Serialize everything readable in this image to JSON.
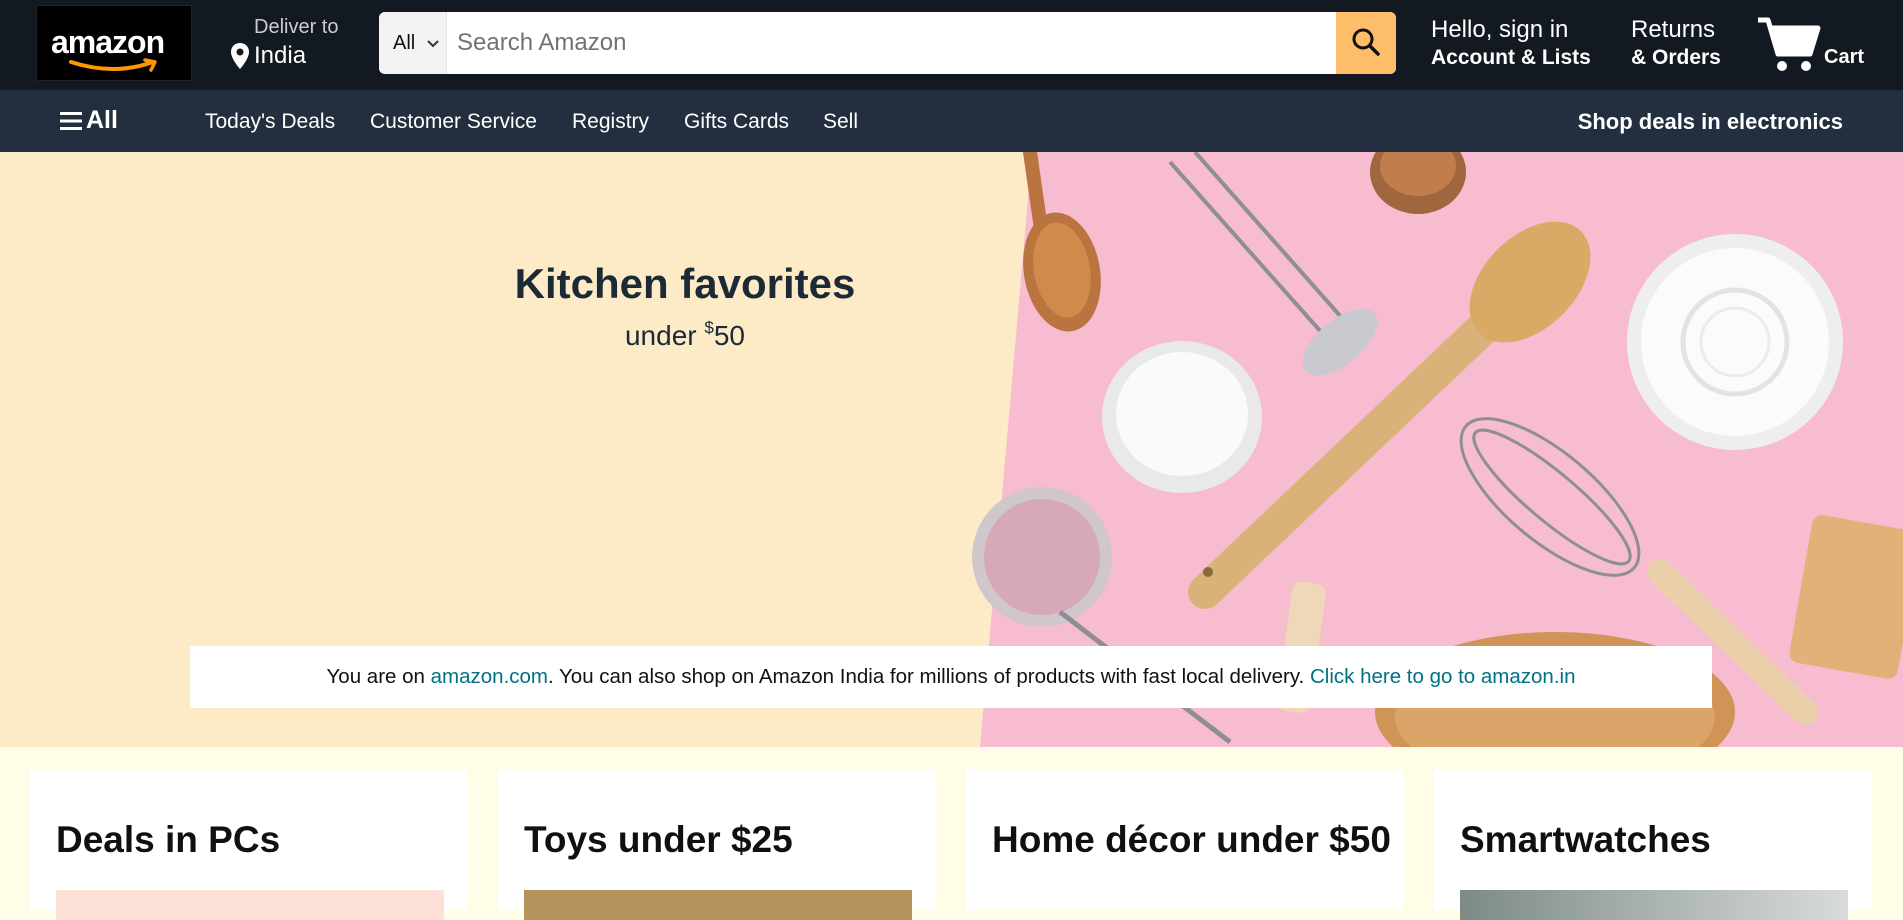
{
  "header": {
    "logo_text": "amazon",
    "deliver_label": "Deliver to",
    "deliver_location": "India",
    "search": {
      "category": "All",
      "placeholder": "Search Amazon"
    },
    "account_greeting": "Hello, sign in",
    "account_label": "Account & Lists",
    "returns_label": "Returns",
    "orders_label": "& Orders",
    "cart_label": "Cart",
    "icons": [
      "location-pin-icon",
      "chevron-down-icon",
      "search-icon",
      "cart-icon",
      "hamburger-menu-icon"
    ]
  },
  "subnav": {
    "all_label": "All",
    "items": [
      "Today's Deals",
      "Customer Service",
      "Registry",
      "Gifts Cards",
      "Sell"
    ],
    "promo": "Shop deals in electronics"
  },
  "hero": {
    "title": "Kitchen favorites",
    "subtitle_prefix": "under ",
    "subtitle_currency": "$",
    "subtitle_amount": "50"
  },
  "notice": {
    "text_before": "You are on ",
    "site_link": "amazon.com",
    "text_middle": ". You can also shop on Amazon India for millions of products with fast local delivery. ",
    "cta_link": "Click here to go to amazon.in"
  },
  "cards": [
    {
      "title": "Deals in PCs"
    },
    {
      "title": "Toys under $25"
    },
    {
      "title": "Home décor under $50"
    },
    {
      "title": "Smartwatches"
    }
  ],
  "colors": {
    "nav_dark": "#131921",
    "subnav": "#232f3e",
    "search_button": "#febd69",
    "hero_left_bg": "#fdebc8",
    "hero_right_bg": "#f8bcd0",
    "link": "#007185",
    "page_bg": "#fffde8"
  }
}
